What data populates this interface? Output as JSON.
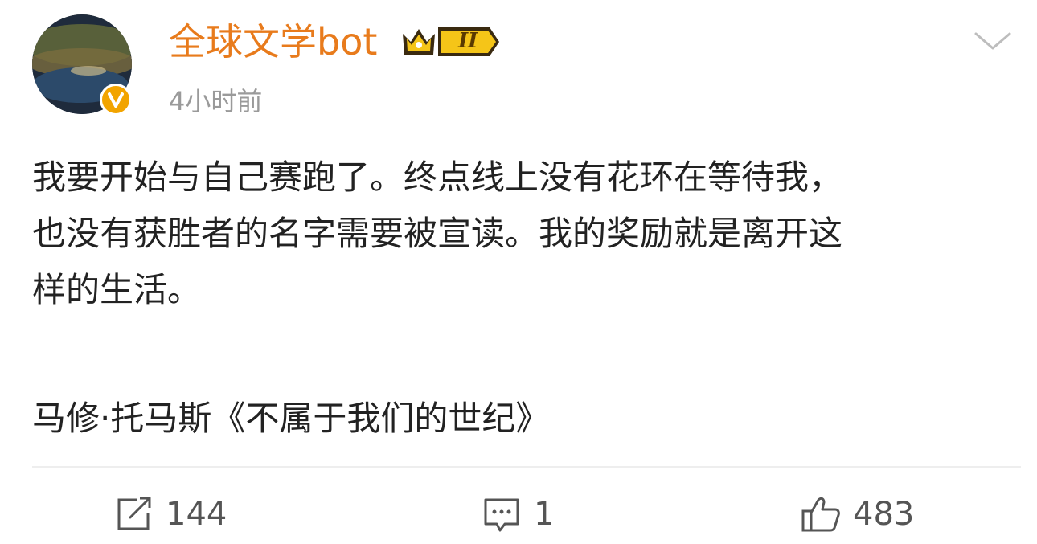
{
  "post": {
    "author": {
      "name": "全球文学bot",
      "level": "II"
    },
    "timestamp": "4小时前",
    "paragraphs": [
      "我要开始与自己赛跑了。终点线上没有花环在等待我，\n也没有获胜者的名字需要被宣读。我的奖励就是离开这\n样的生活。"
    ],
    "attribution": "马修·托马斯《不属于我们的世纪》"
  },
  "actions": {
    "repost": {
      "icon": "repost-icon",
      "count": "144"
    },
    "comment": {
      "icon": "comment-icon",
      "count": "1"
    },
    "like": {
      "icon": "thumbs-up-icon",
      "count": "483"
    }
  },
  "colors": {
    "username": "#e87b1c",
    "timestamp": "#9a9a9a",
    "verified": "#f2a400",
    "level_badge": "#f5c518"
  }
}
